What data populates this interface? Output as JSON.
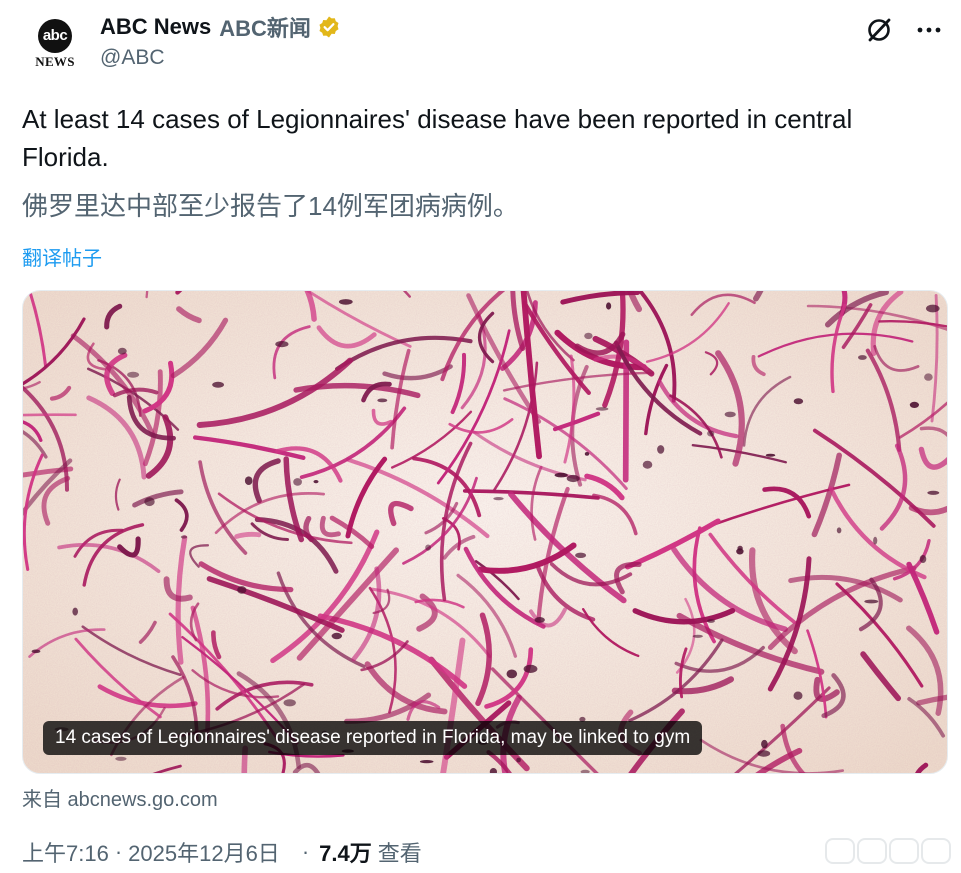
{
  "account": {
    "display_name": "ABC News",
    "display_name_cn": "ABC新闻",
    "handle": "@ABC",
    "avatar_text": "abc",
    "avatar_subtext": "NEWS"
  },
  "icons": {
    "verified": "verified-gold-badge-icon",
    "grok": "grok-icon",
    "more": "more-options-icon",
    "verified_color": "#e2b719"
  },
  "tweet": {
    "text": "At least 14 cases of Legionnaires' disease have been reported in central Florida.",
    "translation": "佛罗里达中部至少报告了14例军团病病例。",
    "translate_label": "翻译帖子"
  },
  "card": {
    "caption": "14 cases of Legionnaires' disease reported in Florida, may be linked to gym",
    "source": "来自 abcnews.go.com",
    "image_subject": "stained-bacteria-micrograph"
  },
  "meta": {
    "time": "上午7:16",
    "date": "2025年12月6日",
    "views_count": "7.4万",
    "views_label": "查看"
  },
  "colors": {
    "link": "#1d9bf0",
    "secondary_text": "#536471",
    "primary_text": "#0f1419",
    "stain": "#b01860"
  }
}
